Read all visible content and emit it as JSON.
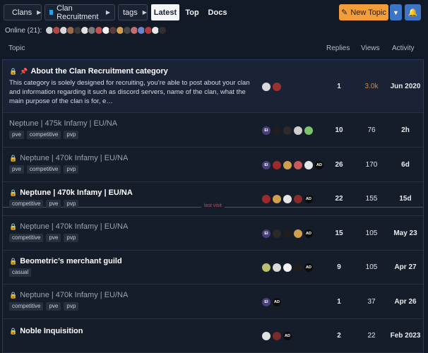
{
  "nav": {
    "crumbs": [
      {
        "label": "Clans",
        "color": "#e0593a"
      },
      {
        "label": "Clan Recruitment",
        "color": "#2e9fe6"
      },
      {
        "label": "tags",
        "color": ""
      }
    ],
    "links": [
      "Latest",
      "Top",
      "Docs"
    ],
    "active_link": "Latest",
    "new_topic_label": "New Topic",
    "accent": "#f29c3a",
    "primary": "#3d74c4"
  },
  "online": {
    "label": "Online (21):",
    "avatar_colors": [
      "#cfd3d8",
      "#b04848",
      "#d8d8d8",
      "#9e6b4a",
      "#3a3a3a",
      "#e0e0e0",
      "#7a7a7a",
      "#c85050",
      "#f2f2f2",
      "#5c3a3a",
      "#d0a050",
      "#484848",
      "#c07070",
      "#6a86c8",
      "#b53a3a",
      "#e8e8e8",
      "#303030"
    ]
  },
  "header": {
    "topic": "Topic",
    "replies": "Replies",
    "views": "Views",
    "activity": "Activity"
  },
  "last_visit": "last visit",
  "topics": [
    {
      "title": "About the Clan Recruitment category",
      "locked": true,
      "pinned": true,
      "bold": true,
      "excerpt": "This category is solely designed for recruiting, you’re able to post about your clan and information regarding it such as discord servers, name of the clan, what the main purpose of the clan is for, e…",
      "tags": [],
      "posters": [
        {
          "t": "",
          "c": "#d9d9d9"
        },
        {
          "t": "",
          "c": "#9a3030"
        }
      ],
      "replies": "1",
      "views": "3.0k",
      "views_hot": true,
      "activity": "Jun 2020"
    },
    {
      "title": "Neptune | 475k Infamy | EU/NA",
      "locked": false,
      "pinned": false,
      "bold": false,
      "excerpt": "",
      "tags": [
        "pve",
        "competitive",
        "pvp"
      ],
      "posters": [
        {
          "t": "EI",
          "c": "#4a3f7a"
        },
        {
          "t": "",
          "c": "#1e1e1e"
        },
        {
          "t": "",
          "c": "#2b2b2b"
        },
        {
          "t": "",
          "c": "#cfcfcf"
        },
        {
          "t": "",
          "c": "#7ac46a"
        }
      ],
      "replies": "10",
      "views": "76",
      "views_hot": false,
      "activity": "2h"
    },
    {
      "title": "Neptune | 470k Infamy | EU/NA",
      "locked": true,
      "pinned": false,
      "bold": false,
      "excerpt": "",
      "tags": [
        "pve",
        "competitive",
        "pvp"
      ],
      "posters": [
        {
          "t": "EI",
          "c": "#4a3f7a"
        },
        {
          "t": "",
          "c": "#9e2b2b"
        },
        {
          "t": "",
          "c": "#d0a050"
        },
        {
          "t": "",
          "c": "#c85a5a"
        },
        {
          "t": "",
          "c": "#e6e6e6"
        },
        {
          "t": "AD",
          "c": "#0c0c0c"
        }
      ],
      "replies": "26",
      "views": "170",
      "views_hot": false,
      "activity": "6d"
    },
    {
      "title": "Neptune | 470k Infamy | EU/NA",
      "locked": true,
      "pinned": false,
      "bold": true,
      "excerpt": "",
      "tags": [
        "competitive",
        "pve",
        "pvp"
      ],
      "posters": [
        {
          "t": "",
          "c": "#9e2b2b"
        },
        {
          "t": "",
          "c": "#d0a050"
        },
        {
          "t": "",
          "c": "#e6e6e6"
        },
        {
          "t": "",
          "c": "#8a2a2a"
        },
        {
          "t": "AD",
          "c": "#0c0c0c"
        }
      ],
      "replies": "22",
      "views": "155",
      "views_hot": false,
      "activity": "15d"
    },
    {
      "title": "Neptune | 470k Infamy | EU/NA",
      "locked": true,
      "pinned": false,
      "bold": false,
      "excerpt": "",
      "tags": [
        "competitive",
        "pve",
        "pvp"
      ],
      "posters": [
        {
          "t": "EI",
          "c": "#4a3f7a"
        },
        {
          "t": "",
          "c": "#2a2a2a"
        },
        {
          "t": "",
          "c": "#1e1e1e"
        },
        {
          "t": "",
          "c": "#d0a050"
        },
        {
          "t": "AD",
          "c": "#0c0c0c"
        }
      ],
      "replies": "15",
      "views": "105",
      "views_hot": false,
      "activity": "May 23"
    },
    {
      "title": "Beometric’s merchant guild",
      "locked": true,
      "pinned": false,
      "bold": true,
      "excerpt": "",
      "tags": [
        "casual"
      ],
      "posters": [
        {
          "t": "",
          "c": "#b8c070"
        },
        {
          "t": "",
          "c": "#d9d9d9"
        },
        {
          "t": "",
          "c": "#f2f2f2"
        },
        {
          "t": "",
          "c": "#1e1e1e"
        },
        {
          "t": "AD",
          "c": "#0c0c0c"
        }
      ],
      "replies": "9",
      "views": "105",
      "views_hot": false,
      "activity": "Apr 27"
    },
    {
      "title": "Neptune | 470k Infamy | EU/NA",
      "locked": true,
      "pinned": false,
      "bold": false,
      "excerpt": "",
      "tags": [
        "competitive",
        "pve",
        "pvp"
      ],
      "posters": [
        {
          "t": "EI",
          "c": "#4a3f7a"
        },
        {
          "t": "AD",
          "c": "#0c0c0c"
        }
      ],
      "replies": "1",
      "views": "37",
      "views_hot": false,
      "activity": "Apr 26"
    },
    {
      "title": "Noble Inquisition",
      "locked": true,
      "pinned": false,
      "bold": true,
      "excerpt": "",
      "tags": [],
      "posters": [
        {
          "t": "",
          "c": "#e0e0e0"
        },
        {
          "t": "",
          "c": "#7a2a2a"
        },
        {
          "t": "AD",
          "c": "#0c0c0c"
        }
      ],
      "replies": "2",
      "views": "22",
      "views_hot": false,
      "activity": "Feb 2023"
    }
  ]
}
